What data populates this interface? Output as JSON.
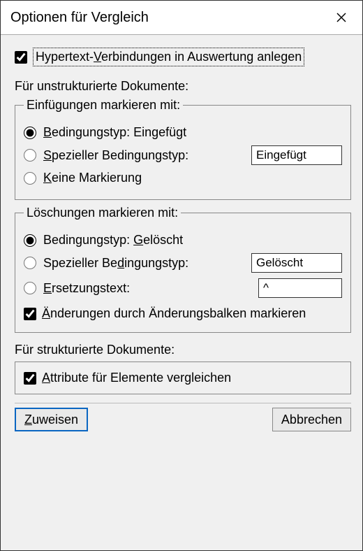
{
  "title": "Optionen für Vergleich",
  "hypertext": {
    "label_pre": "Hypertext-",
    "label_key": "V",
    "label_post": "erbindungen in Auswertung anlegen",
    "checked": true
  },
  "unstructured_label": "Für unstrukturierte Dokumente:",
  "insertions": {
    "legend": "Einfügungen markieren mit:",
    "opt_condtype": {
      "pre": "",
      "key": "B",
      "post": "edingungstyp: Eingefügt"
    },
    "opt_special": {
      "pre": "",
      "key": "S",
      "post": "pezieller Bedingungstyp:"
    },
    "opt_none": {
      "pre": "",
      "key": "K",
      "post": "eine Markierung"
    },
    "special_value": "Eingefügt",
    "selected": "condtype"
  },
  "deletions": {
    "legend": "Löschungen markieren mit:",
    "opt_condtype": {
      "pre": "Bedingungstyp: ",
      "key": "G",
      "post": "elöscht"
    },
    "opt_special": {
      "pre": "Spezieller Be",
      "key": "d",
      "post": "ingungstyp:"
    },
    "opt_replace": {
      "pre": "",
      "key": "E",
      "post": "rsetzungstext:"
    },
    "special_value": "Gelöscht",
    "replace_value": "^",
    "selected": "condtype",
    "changebars": {
      "pre": "",
      "key": "Ä",
      "post": "nderungen durch Änderungsbalken markieren",
      "checked": true
    }
  },
  "structured_label": "Für strukturierte Dokumente:",
  "attributes": {
    "pre": "",
    "key": "A",
    "post": "ttribute für Elemente vergleichen",
    "checked": true
  },
  "buttons": {
    "assign": {
      "pre": "",
      "key": "Z",
      "post": "uweisen"
    },
    "cancel": "Abbrechen"
  }
}
